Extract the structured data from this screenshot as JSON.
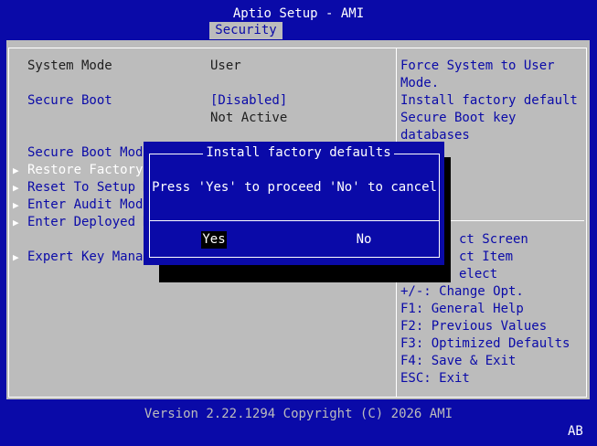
{
  "header": {
    "title": "Aptio Setup - AMI",
    "tab": "Security"
  },
  "settings": {
    "system_mode_label": "System Mode",
    "system_mode_value": "User",
    "secure_boot_label": "Secure Boot",
    "secure_boot_value": "[Disabled]",
    "secure_boot_status": "Not Active",
    "secure_boot_mode_label": "Secure Boot Mode",
    "menu_items": [
      "Restore Factory",
      "Reset To Setup M",
      "Enter Audit Mode",
      "Enter Deployed M",
      "Expert Key Manag"
    ]
  },
  "help": {
    "desc_lines": [
      "Force System to User",
      "Mode.",
      "Install factory default",
      "Secure Boot key",
      "databases"
    ],
    "keys": [
      "ct Screen",
      "ct Item",
      "elect",
      "+/-: Change Opt.",
      "F1: General Help",
      "F2: Previous Values",
      "F3: Optimized Defaults",
      "F4: Save & Exit",
      "ESC: Exit"
    ]
  },
  "dialog": {
    "title": "Install factory defaults",
    "message": "Press 'Yes' to proceed 'No' to cancel",
    "yes_label": "Yes",
    "no_label": "No"
  },
  "footer": {
    "version": "Version 2.22.1294 Copyright (C) 2026 AMI",
    "badge": "AB"
  },
  "colors": {
    "background": "#0a0aa8",
    "panel": "#bcbcbc",
    "text_blue": "#0a0aa8",
    "text_dark": "#1e1e1e",
    "text_white": "#ffffff",
    "highlight": "#000000"
  }
}
